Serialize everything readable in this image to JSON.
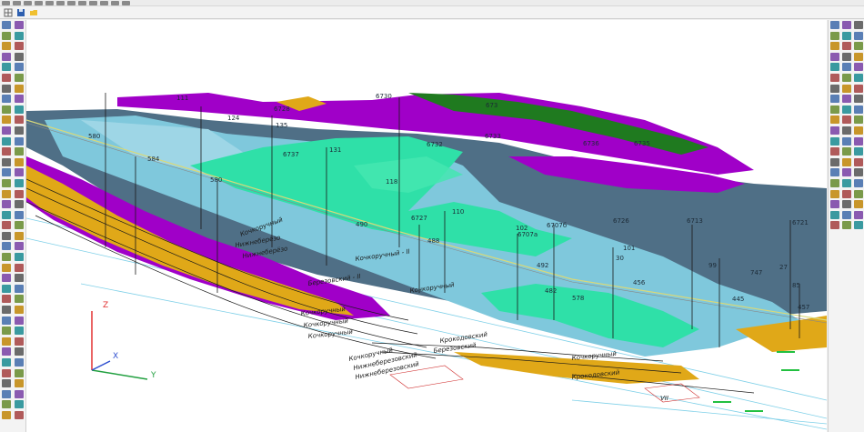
{
  "colors": {
    "accent_green": "#2fe0a8",
    "steel_blue": "#4f6f86",
    "sky_blue": "#7fc8dc",
    "purple": "#a000c8",
    "orange": "#e0a818",
    "dark_green": "#1f7a1f",
    "axis_x": "#e23030",
    "axis_y": "#22a040",
    "axis_z": "#3050d0"
  },
  "toolbar": {
    "top_icons": [
      "grid-icon",
      "save-icon",
      "folder-icon"
    ],
    "left_icons": [
      "layer-icon",
      "page-icon",
      "stack-icon",
      "rotate-icon",
      "copy-icon",
      "link-icon",
      "refresh-icon",
      "node-icon",
      "star-icon",
      "filter-icon",
      "search-icon",
      "zoom-icon",
      "lock-icon",
      "cross-icon",
      "close-icon",
      "scissor-icon",
      "edit-icon",
      "pen-icon",
      "line-icon",
      "curve-icon",
      "dot-icon",
      "circle-icon",
      "grid-icon",
      "table-icon",
      "chart-icon",
      "plus-icon",
      "stack-icon",
      "layer-icon",
      "cube-icon",
      "cube-icon",
      "ruler-icon",
      "sum-icon",
      "measure-icon",
      "cut-icon",
      "drop-icon",
      "tag-icon",
      "text-icon",
      "chevron-icon"
    ],
    "right_icons": [
      "layer-icon",
      "move-icon",
      "rotate-icon",
      "zoom-icon",
      "pan-icon",
      "copy-icon",
      "paste-icon",
      "link-icon",
      "grid-icon",
      "cube-icon",
      "light-icon",
      "camera-icon",
      "eye-icon",
      "home-icon",
      "color-icon",
      "filter-icon",
      "tag-icon",
      "ruler-icon",
      "section-icon",
      "view-icon"
    ]
  },
  "well_labels": [
    {
      "id": "w-111",
      "text": "111"
    },
    {
      "id": "w-124",
      "text": "124"
    },
    {
      "id": "w-6728",
      "text": "6728"
    },
    {
      "id": "w-135",
      "text": "135"
    },
    {
      "id": "w-6730",
      "text": "6730"
    },
    {
      "id": "w-6733",
      "text": "6733"
    },
    {
      "id": "w-6736",
      "text": "6736"
    },
    {
      "id": "w-6735",
      "text": "6735"
    },
    {
      "id": "w-673",
      "text": "673"
    },
    {
      "id": "w-580",
      "text": "580"
    },
    {
      "id": "w-584",
      "text": "584"
    },
    {
      "id": "w-6737",
      "text": "6737"
    },
    {
      "id": "w-131",
      "text": "131"
    },
    {
      "id": "w-6732",
      "text": "6732"
    },
    {
      "id": "w-580b",
      "text": "580"
    },
    {
      "id": "w-118",
      "text": "118"
    },
    {
      "id": "w-110",
      "text": "110"
    },
    {
      "id": "w-6727",
      "text": "6727"
    },
    {
      "id": "w-490",
      "text": "490"
    },
    {
      "id": "w-488",
      "text": "488"
    },
    {
      "id": "w-492",
      "text": "492"
    },
    {
      "id": "w-102",
      "text": "102"
    },
    {
      "id": "w-6707a",
      "text": "6707a"
    },
    {
      "id": "w-6707б",
      "text": "6707б"
    },
    {
      "id": "w-6726",
      "text": "6726"
    },
    {
      "id": "w-6713",
      "text": "6713"
    },
    {
      "id": "w-6721",
      "text": "6721"
    },
    {
      "id": "w-101",
      "text": "101"
    },
    {
      "id": "w-30",
      "text": "30"
    },
    {
      "id": "w-456",
      "text": "456"
    },
    {
      "id": "w-99",
      "text": "99"
    },
    {
      "id": "w-747",
      "text": "747"
    },
    {
      "id": "w-27",
      "text": "27"
    },
    {
      "id": "w-85",
      "text": "85"
    },
    {
      "id": "w-445",
      "text": "445"
    },
    {
      "id": "w-457",
      "text": "457"
    },
    {
      "id": "w-482",
      "text": "482"
    },
    {
      "id": "w-578",
      "text": "578"
    }
  ],
  "horizon_labels": [
    {
      "id": "h-1",
      "text": "Кочкоручный"
    },
    {
      "id": "h-2",
      "text": "Нижнеберёзо"
    },
    {
      "id": "h-3",
      "text": "Нижнеберёзо"
    },
    {
      "id": "h-4",
      "text": "Кочкоручный - II"
    },
    {
      "id": "h-5",
      "text": "Кочкоручный"
    },
    {
      "id": "h-6",
      "text": "Березовский - II"
    },
    {
      "id": "h-7",
      "text": "Кочкоручный"
    },
    {
      "id": "h-8",
      "text": "Кочкоручный"
    },
    {
      "id": "h-9",
      "text": "Кочкоручный"
    },
    {
      "id": "h-10",
      "text": "Крокодовский"
    },
    {
      "id": "h-11",
      "text": "Березовский"
    },
    {
      "id": "h-12",
      "text": "Нижнеберезовский"
    },
    {
      "id": "h-13",
      "text": "Кочкоручный"
    },
    {
      "id": "h-14",
      "text": "Крокодовский"
    },
    {
      "id": "h-15",
      "text": "Нижнеберезовский"
    },
    {
      "id": "h-16",
      "text": "Кочкоручный"
    },
    {
      "id": "h-17",
      "text": "VII"
    }
  ],
  "axes": {
    "x": "X",
    "y": "Y",
    "z": "Z"
  }
}
